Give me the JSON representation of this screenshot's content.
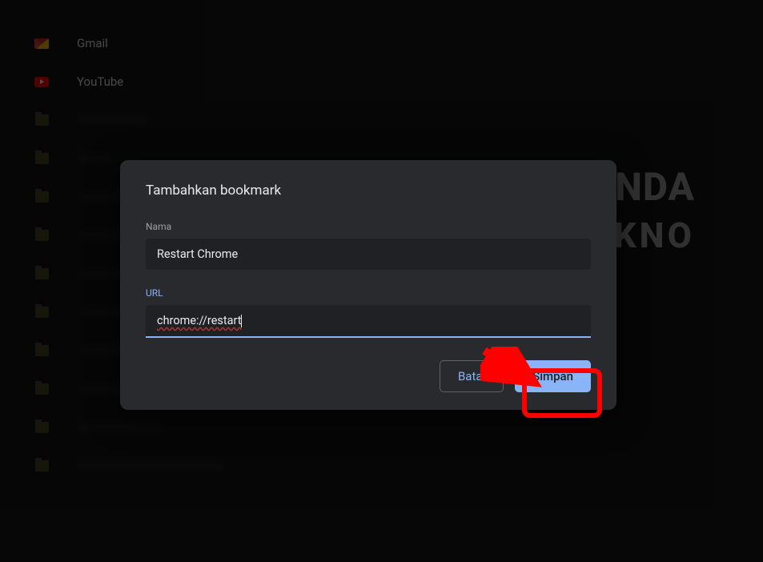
{
  "sidebar": {
    "items": [
      {
        "type": "gmail",
        "label": "Gmail"
      },
      {
        "type": "youtube",
        "label": "YouTube"
      },
      {
        "type": "folder",
        "blurred": true,
        "w": "w90"
      },
      {
        "type": "folder",
        "blurred": true,
        "w": "w60"
      },
      {
        "type": "folder",
        "blurred": true,
        "w": "w90"
      },
      {
        "type": "folder",
        "blurred": true,
        "w": "w90"
      },
      {
        "type": "folder",
        "blurred": true,
        "w": "w110"
      },
      {
        "type": "folder",
        "blurred": true,
        "w": "w70"
      },
      {
        "type": "folder",
        "blurred": true,
        "w": "w110"
      },
      {
        "type": "folder",
        "blurred": true,
        "w": "w70"
      },
      {
        "type": "folder",
        "blurred": true,
        "w": "w110"
      },
      {
        "type": "folder",
        "blurred": true,
        "w": "w180"
      }
    ]
  },
  "dialog": {
    "title": "Tambahkan bookmark",
    "name_label": "Nama",
    "name_value": "Restart Chrome",
    "url_label": "URL",
    "url_value": "chrome://restart",
    "cancel": "Batal",
    "save": "Simpan"
  },
  "watermark": {
    "line1": "AFUNDA",
    "line2": "TEKNO"
  }
}
